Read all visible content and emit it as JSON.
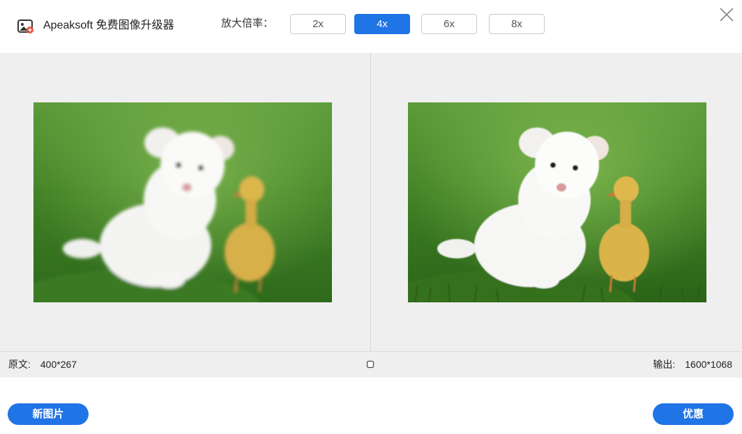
{
  "header": {
    "app_title": "Apeaksoft 免费图像升级器",
    "zoom_label": "放大倍率：",
    "zoom_options": [
      "2x",
      "4x",
      "6x",
      "8x"
    ],
    "zoom_selected": "4x",
    "logo_icon": "image-upscaler-logo-icon",
    "close_icon": "close-icon"
  },
  "preview": {
    "original_photo": "puppy-and-duckling-photo",
    "output_photo": "puppy-and-duckling-photo-upscaled"
  },
  "info": {
    "original_label": "原文:",
    "original_size": "400*267",
    "output_label": "输出:",
    "output_size": "1600*1068",
    "compare_icon": "compare-square-icon"
  },
  "footer": {
    "new_image_label": "新图片",
    "save_label": "优惠"
  },
  "colors": {
    "accent": "#1f74e6",
    "preview_bg": "#efefef",
    "grass": "#4f8f2a",
    "puppy": "#f5f5f5",
    "duckling": "#e2b94a"
  }
}
